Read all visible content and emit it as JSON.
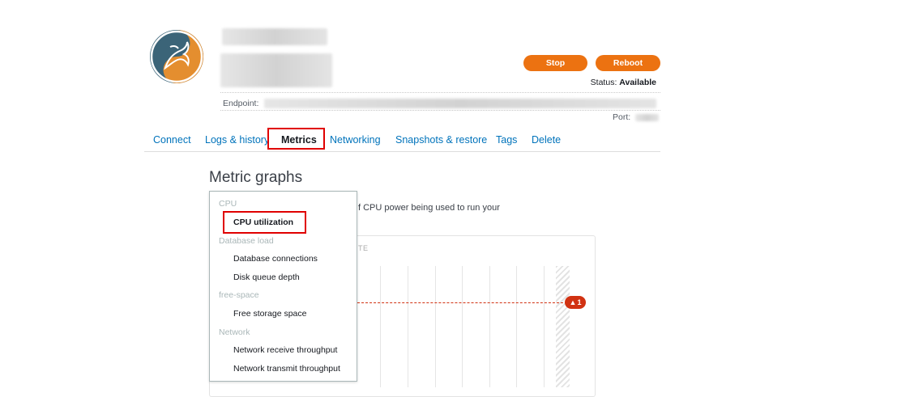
{
  "header": {
    "stop_label": "Stop",
    "reboot_label": "Reboot",
    "status_label": "Status:",
    "status_value": "Available",
    "endpoint_label": "Endpoint:",
    "port_label": "Port:",
    "logo_icon": "mysql-dolphin-icon",
    "accent_color": "#ec7211"
  },
  "tabs": [
    {
      "label": "Connect"
    },
    {
      "label": "Logs & history"
    },
    {
      "label": "Metrics",
      "active": true
    },
    {
      "label": "Networking"
    },
    {
      "label": "Snapshots & restore"
    },
    {
      "label": "Tags"
    },
    {
      "label": "Delete"
    }
  ],
  "metrics": {
    "title": "Metric graphs",
    "description": "f CPU power being used to run your",
    "chart_header_fragment": "TE",
    "alarm_badge": "1",
    "alarm_color": "#d13212"
  },
  "dropdown": {
    "groups": [
      {
        "label": "CPU",
        "options": [
          {
            "label": "CPU utilization",
            "selected": true
          }
        ]
      },
      {
        "label": "Database load",
        "options": [
          {
            "label": "Database connections"
          },
          {
            "label": "Disk queue depth"
          }
        ]
      },
      {
        "label": "free-space",
        "options": [
          {
            "label": "Free storage space"
          }
        ]
      },
      {
        "label": "Network",
        "options": [
          {
            "label": "Network receive throughput"
          },
          {
            "label": "Network transmit throughput"
          }
        ]
      }
    ]
  }
}
